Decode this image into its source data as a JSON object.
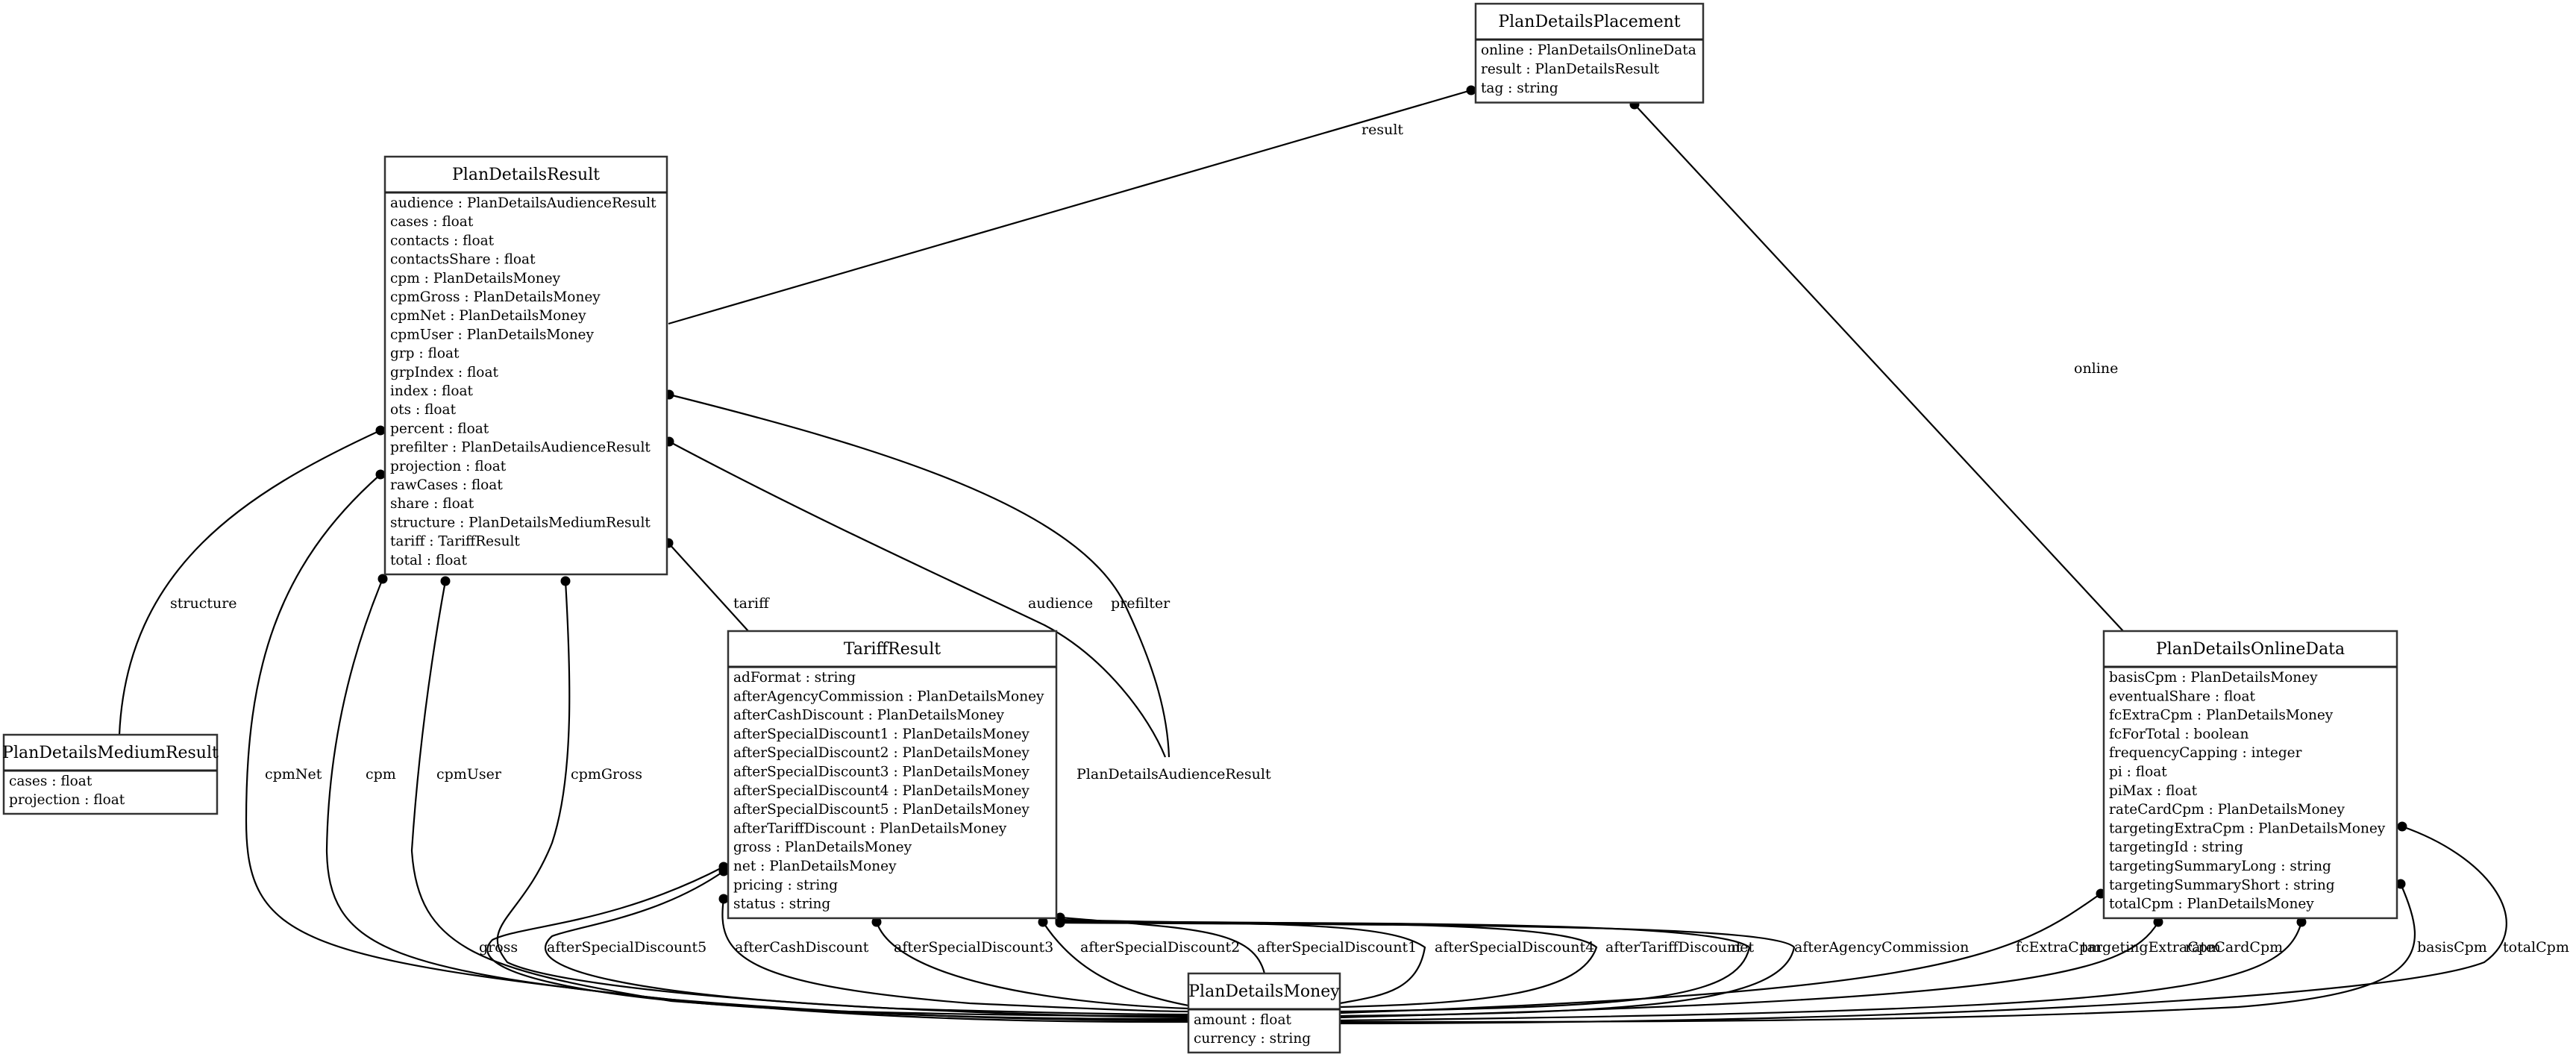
{
  "diagram": {
    "type": "uml-class-diagram",
    "nodes": {
      "placement": {
        "title": "PlanDetailsPlacement",
        "fields": [
          "online : PlanDetailsOnlineData",
          "result : PlanDetailsResult",
          "tag : string"
        ]
      },
      "result": {
        "title": "PlanDetailsResult",
        "fields": [
          "audience : PlanDetailsAudienceResult",
          "cases : float",
          "contacts : float",
          "contactsShare : float",
          "cpm : PlanDetailsMoney",
          "cpmGross : PlanDetailsMoney",
          "cpmNet : PlanDetailsMoney",
          "cpmUser : PlanDetailsMoney",
          "grp : float",
          "grpIndex : float",
          "index : float",
          "ots : float",
          "percent : float",
          "prefilter : PlanDetailsAudienceResult",
          "projection : float",
          "rawCases : float",
          "share : float",
          "structure : PlanDetailsMediumResult",
          "tariff : TariffResult",
          "total : float"
        ]
      },
      "medium": {
        "title": "PlanDetailsMediumResult",
        "fields": [
          "cases : float",
          "projection : float"
        ]
      },
      "tariff": {
        "title": "TariffResult",
        "fields": [
          "adFormat : string",
          "afterAgencyCommission : PlanDetailsMoney",
          "afterCashDiscount : PlanDetailsMoney",
          "afterSpecialDiscount1 : PlanDetailsMoney",
          "afterSpecialDiscount2 : PlanDetailsMoney",
          "afterSpecialDiscount3 : PlanDetailsMoney",
          "afterSpecialDiscount4 : PlanDetailsMoney",
          "afterSpecialDiscount5 : PlanDetailsMoney",
          "afterTariffDiscount : PlanDetailsMoney",
          "gross : PlanDetailsMoney",
          "net : PlanDetailsMoney",
          "pricing : string",
          "status : string"
        ]
      },
      "online": {
        "title": "PlanDetailsOnlineData",
        "fields": [
          "basisCpm : PlanDetailsMoney",
          "eventualShare : float",
          "fcExtraCpm : PlanDetailsMoney",
          "fcForTotal : boolean",
          "frequencyCapping : integer",
          "pi : float",
          "piMax : float",
          "rateCardCpm : PlanDetailsMoney",
          "targetingExtraCpm : PlanDetailsMoney",
          "targetingId : string",
          "targetingSummaryLong : string",
          "targetingSummaryShort : string",
          "totalCpm : PlanDetailsMoney"
        ]
      },
      "money": {
        "title": "PlanDetailsMoney",
        "fields": [
          "amount : float",
          "currency : string"
        ]
      },
      "audience": {
        "title": "PlanDetailsAudienceResult"
      }
    },
    "edges": [
      {
        "id": "e-result",
        "from": "placement",
        "to": "result",
        "label": "result"
      },
      {
        "id": "e-online",
        "from": "placement",
        "to": "online",
        "label": "online"
      },
      {
        "id": "e-structure",
        "from": "result",
        "to": "medium",
        "label": "structure"
      },
      {
        "id": "e-tariff",
        "from": "result",
        "to": "tariff",
        "label": "tariff"
      },
      {
        "id": "e-audience",
        "from": "result",
        "to": "audience",
        "label": "audience"
      },
      {
        "id": "e-prefilter",
        "from": "result",
        "to": "audience",
        "label": "prefilter"
      },
      {
        "id": "e-cpmNet",
        "from": "result",
        "to": "money",
        "label": "cpmNet"
      },
      {
        "id": "e-cpm",
        "from": "result",
        "to": "money",
        "label": "cpm"
      },
      {
        "id": "e-cpmUser",
        "from": "result",
        "to": "money",
        "label": "cpmUser"
      },
      {
        "id": "e-cpmGross",
        "from": "result",
        "to": "money",
        "label": "cpmGross"
      },
      {
        "id": "e-gross",
        "from": "tariff",
        "to": "money",
        "label": "gross"
      },
      {
        "id": "e-asd5",
        "from": "tariff",
        "to": "money",
        "label": "afterSpecialDiscount5"
      },
      {
        "id": "e-acd",
        "from": "tariff",
        "to": "money",
        "label": "afterCashDiscount"
      },
      {
        "id": "e-asd3",
        "from": "tariff",
        "to": "money",
        "label": "afterSpecialDiscount3"
      },
      {
        "id": "e-asd2",
        "from": "tariff",
        "to": "money",
        "label": "afterSpecialDiscount2"
      },
      {
        "id": "e-asd1",
        "from": "tariff",
        "to": "money",
        "label": "afterSpecialDiscount1"
      },
      {
        "id": "e-asd4",
        "from": "tariff",
        "to": "money",
        "label": "afterSpecialDiscount4"
      },
      {
        "id": "e-atd",
        "from": "tariff",
        "to": "money",
        "label": "afterTariffDiscount"
      },
      {
        "id": "e-net",
        "from": "tariff",
        "to": "money",
        "label": "net"
      },
      {
        "id": "e-aac",
        "from": "tariff",
        "to": "money",
        "label": "afterAgencyCommission"
      },
      {
        "id": "e-fcExtraCpm",
        "from": "online",
        "to": "money",
        "label": "fcExtraCpm"
      },
      {
        "id": "e-targetingExtraCpm",
        "from": "online",
        "to": "money",
        "label": "targetingExtraCpm"
      },
      {
        "id": "e-rateCardCpm",
        "from": "online",
        "to": "money",
        "label": "rateCardCpm"
      },
      {
        "id": "e-basisCpm",
        "from": "online",
        "to": "money",
        "label": "basisCpm"
      },
      {
        "id": "e-totalCpm",
        "from": "online",
        "to": "money",
        "label": "totalCpm"
      }
    ]
  }
}
